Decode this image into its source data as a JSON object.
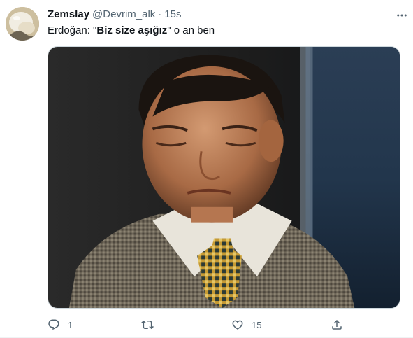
{
  "tweet": {
    "display_name": "Zemslay",
    "handle": "@Devrim_alk",
    "separator": "·",
    "time": "15s",
    "text": {
      "before": "Erdoğan: \"",
      "bold": "Biz size aşığız",
      "after": "\" o an ben"
    },
    "actions": {
      "reply_count": "1",
      "retweet_count": "",
      "like_count": "15"
    }
  },
  "icons": {
    "more": "more-dots-icon",
    "reply": "reply-bubble-icon",
    "retweet": "retweet-icon",
    "like": "heart-icon",
    "share": "share-icon"
  },
  "colors": {
    "text_primary": "#0f1419",
    "text_secondary": "#536471",
    "border": "#cfd9de"
  }
}
